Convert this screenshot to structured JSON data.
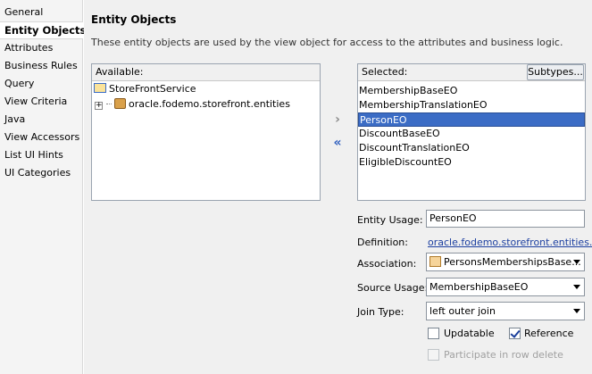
{
  "nav": {
    "items": [
      {
        "label": "General"
      },
      {
        "label": "Entity Objects"
      },
      {
        "label": "Attributes"
      },
      {
        "label": "Business Rules"
      },
      {
        "label": "Query"
      },
      {
        "label": "View Criteria"
      },
      {
        "label": "Java"
      },
      {
        "label": "View Accessors"
      },
      {
        "label": "List UI Hints"
      },
      {
        "label": "UI Categories"
      }
    ],
    "selected": "Entity Objects"
  },
  "page": {
    "title": "Entity Objects",
    "description": "These entity objects are used by the view object for access to the attributes and business logic."
  },
  "available": {
    "header": "Available:",
    "tree": [
      {
        "label": "StoreFrontService",
        "icon": "service-icon"
      },
      {
        "label": "oracle.fodemo.storefront.entities",
        "icon": "package-icon",
        "expander": "+"
      }
    ]
  },
  "shuttle": {
    "add": "›",
    "remove": "«"
  },
  "selected": {
    "header": "Selected:",
    "subtypes_label": "Subtypes...",
    "items": [
      {
        "label": "MembershipBaseEO"
      },
      {
        "label": "MembershipTranslationEO"
      },
      {
        "label": "PersonEO"
      },
      {
        "label": "DiscountBaseEO"
      },
      {
        "label": "DiscountTranslationEO"
      },
      {
        "label": "EligibleDiscountEO"
      }
    ],
    "active_index": 2
  },
  "form": {
    "entity_usage": {
      "label": "Entity Usage:",
      "value": "PersonEO"
    },
    "definition": {
      "label": "Definition:",
      "value": "oracle.fodemo.storefront.entities...."
    },
    "association": {
      "label": "Association:",
      "value": "PersonsMembershipsBase..."
    },
    "source_usage": {
      "label": "Source Usage:",
      "value": "MembershipBaseEO"
    },
    "join_type": {
      "label": "Join Type:",
      "value": "left outer join"
    },
    "updatable": {
      "label": "Updatable",
      "checked": false
    },
    "reference": {
      "label": "Reference",
      "checked": true
    },
    "participate": {
      "label": "Participate in row delete",
      "checked": false,
      "enabled": false
    }
  },
  "colors": {
    "selection": "#3b6cc5",
    "link": "#1c3fa0"
  }
}
